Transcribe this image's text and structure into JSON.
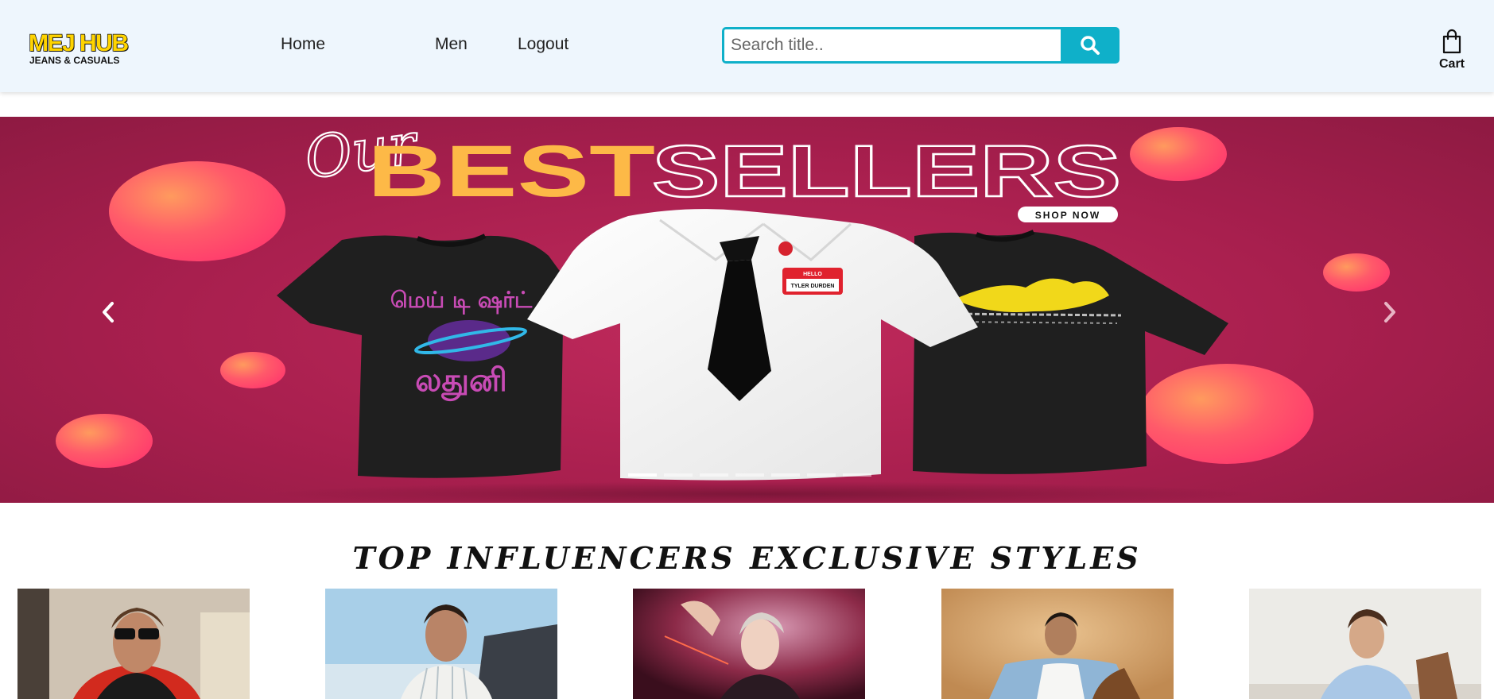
{
  "brand": {
    "name": "MEJ HUB",
    "tagline": "JEANS & CASUALS"
  },
  "nav": {
    "links": [
      {
        "label": "Home"
      },
      {
        "label": "Men"
      },
      {
        "label": "Logout"
      }
    ]
  },
  "search": {
    "placeholder": "Search title..",
    "value": "",
    "button_icon": "search-icon"
  },
  "cart": {
    "label": "Cart",
    "icon": "shopping-bag-icon"
  },
  "hero": {
    "script_word": "Our",
    "headline_bold": "BEST",
    "headline_outline": "SELLERS",
    "cta": "SHOP NOW",
    "name_tag_top": "HELLO",
    "name_tag_name": "TYLER DURDEN",
    "tee_print_text": "மெய் டி ஷர்ட்",
    "slide_count": 7,
    "active_slide": 1,
    "colors": {
      "background": "#a81f4e",
      "headline_yellow": "#fdb947",
      "bubble": "#ff5c6b"
    }
  },
  "influencers": {
    "title": "TOP INFLUENCERS EXCLUSIVE STYLES",
    "cards": [
      {
        "icon": "influencer-photo-1"
      },
      {
        "icon": "influencer-photo-2"
      },
      {
        "icon": "influencer-photo-3"
      },
      {
        "icon": "influencer-photo-4"
      },
      {
        "icon": "influencer-photo-5"
      }
    ]
  },
  "accent_color": "#0fb0c9"
}
